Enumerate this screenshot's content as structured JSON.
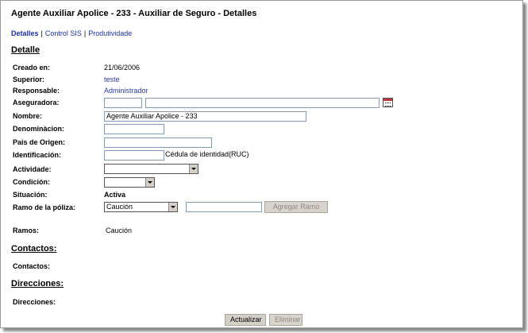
{
  "title": "Agente Auxiliar Apolice - 233 - Auxiliar de Seguro - Detalles",
  "tabs": [
    {
      "label": "Detalles"
    },
    {
      "label": "Control SIS"
    },
    {
      "label": "Produtividade"
    }
  ],
  "tab_separator": "|",
  "sections": {
    "detalle": "Detalle",
    "contactos": "Contactos:",
    "direcciones": "Direcciones:"
  },
  "fields": {
    "creado_en": {
      "label": "Creado en:",
      "value": "21/06/2006"
    },
    "superior": {
      "label": "Superior:",
      "value": "teste"
    },
    "responsable": {
      "label": "Responsable:",
      "value": "Administrador"
    },
    "aseguradora": {
      "label": "Aseguradora:",
      "code": "",
      "name": ""
    },
    "nombre": {
      "label": "Nombre:",
      "value": "Agente Auxiliar Apolice - 233"
    },
    "denominacion": {
      "label": "Denominàcion:",
      "value": ""
    },
    "pais": {
      "label": "Pais de Origen:",
      "value": ""
    },
    "identificacion": {
      "label": "Identificación:",
      "value": "",
      "hint": "Cédula de identidad(RUC)"
    },
    "actividade": {
      "label": "Actividade:",
      "value": ""
    },
    "condicion": {
      "label": "Condición:",
      "value": ""
    },
    "situacion": {
      "label": "Situación:",
      "value": "Activa"
    },
    "ramo": {
      "label": "Ramo de la póliza:",
      "selected": "Caución",
      "extra": "",
      "add_button": "Agregar Ramo"
    },
    "ramos": {
      "label": "Ramos:",
      "value": "Caución"
    },
    "contactos": {
      "label": "Contactos:"
    },
    "direcciones": {
      "label": "Direcciones:"
    }
  },
  "buttons": {
    "actualizar": "Actualizar",
    "eliminar": "Eliminar"
  },
  "icons": {
    "calendar": "calendar-icon",
    "dropdown": "chevron-down-icon"
  }
}
